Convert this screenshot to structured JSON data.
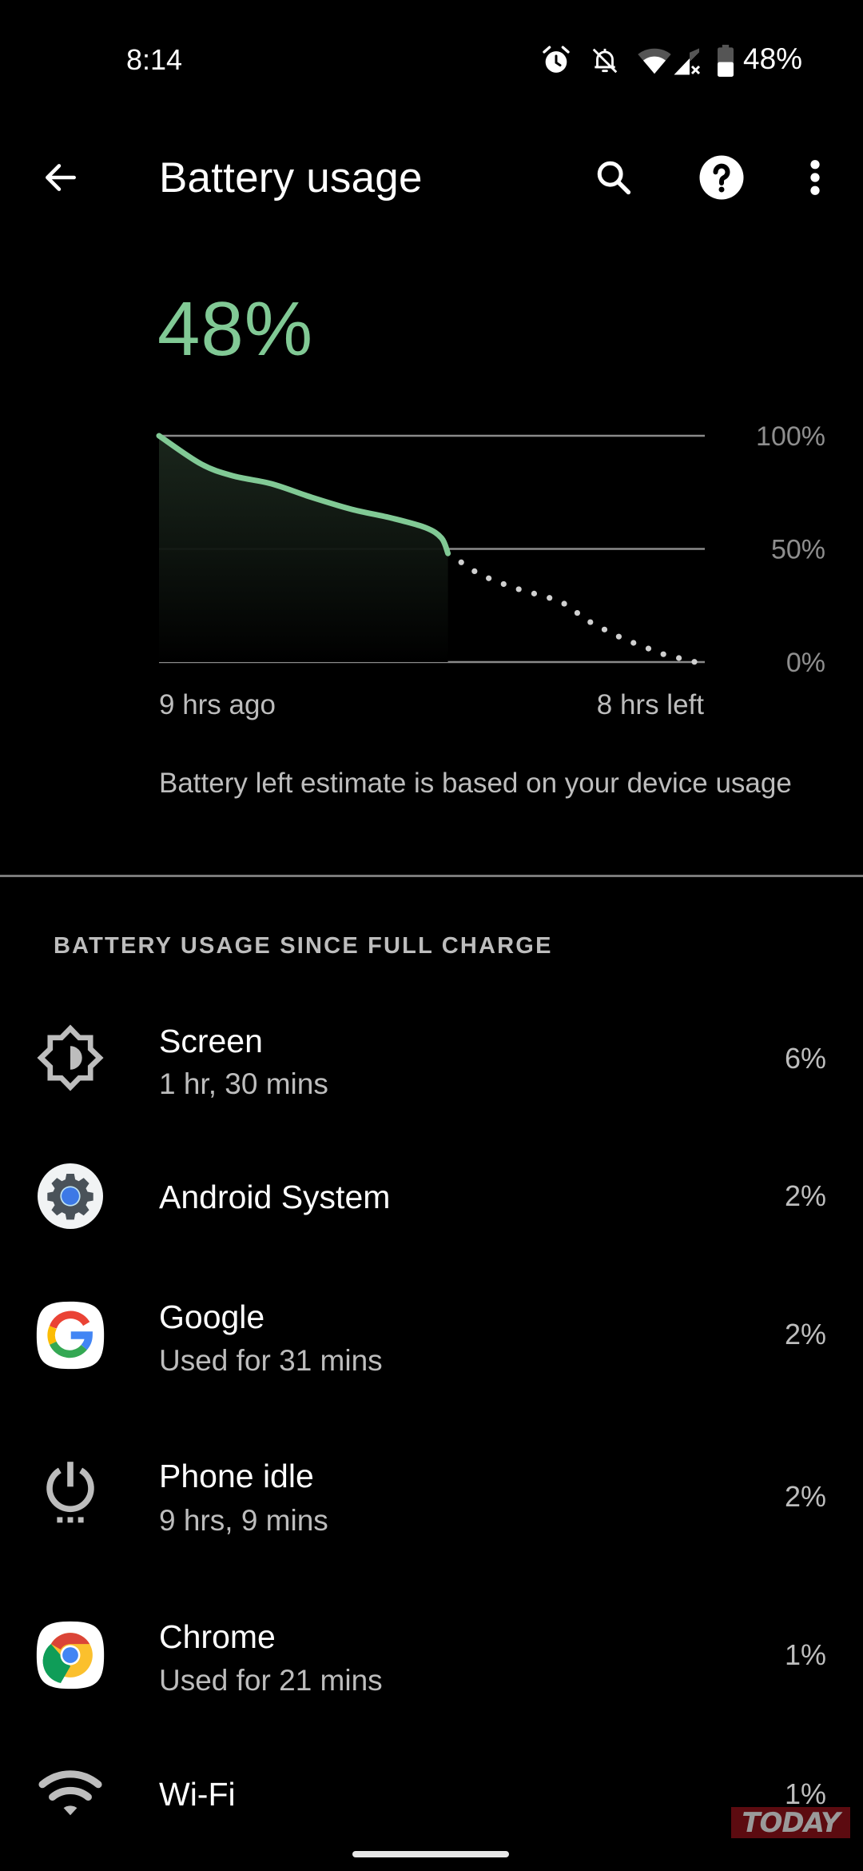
{
  "status_bar": {
    "time": "8:14",
    "icons": [
      "alarm-icon",
      "notifications-off-icon",
      "wifi-icon",
      "cell-signal-no-data-icon",
      "battery-icon"
    ],
    "battery_percent": "48%"
  },
  "app_bar": {
    "title": "Battery usage",
    "actions": [
      "back-arrow-icon",
      "search-icon",
      "help-icon",
      "more-vert-icon"
    ]
  },
  "battery": {
    "level_label": "48%",
    "level": 48,
    "color": "#81c995"
  },
  "chart_data": {
    "type": "line",
    "title": "",
    "xlabel": "",
    "ylabel": "",
    "x_unit": "hours",
    "xlim": [
      0,
      17
    ],
    "ylim": [
      0,
      100
    ],
    "y_ticks": [
      "100%",
      "50%",
      "0%"
    ],
    "y_tick_values": [
      100,
      50,
      0
    ],
    "x_tick_labels": [
      "9 hrs ago",
      "8 hrs left"
    ],
    "grid": true,
    "series": [
      {
        "name": "Battery level (history)",
        "style": "solid",
        "color": "#81c995",
        "x": [
          0,
          1.3,
          2.3,
          3.5,
          4.75,
          6.0,
          7.25,
          8.3,
          8.8,
          9.0
        ],
        "y": [
          100,
          87.6,
          82.3,
          78.8,
          72.8,
          67.5,
          63.6,
          59.4,
          54.8,
          48
        ]
      },
      {
        "name": "Projected battery level",
        "style": "dotted",
        "color": "#d0d0d0",
        "x": [
          9.0,
          10.0,
          11.0,
          12.5,
          13.5,
          14.5,
          15.7,
          16.7
        ],
        "y": [
          48,
          38.5,
          33,
          27,
          17,
          10,
          3.5,
          0
        ]
      }
    ]
  },
  "estimate_note": "Battery left estimate is based on your device usage",
  "section_header": "BATTERY USAGE SINCE FULL CHARGE",
  "usage_items": [
    {
      "icon": "brightness-icon",
      "title": "Screen",
      "subtitle": "1 hr, 30 mins",
      "percent": "6%"
    },
    {
      "icon": "android-system-gear-icon",
      "title": "Android System",
      "subtitle": "",
      "percent": "2%"
    },
    {
      "icon": "google-icon",
      "title": "Google",
      "subtitle": "Used for 31 mins",
      "percent": "2%"
    },
    {
      "icon": "power-idle-icon",
      "title": "Phone idle",
      "subtitle": "9 hrs, 9 mins",
      "percent": "2%"
    },
    {
      "icon": "chrome-icon",
      "title": "Chrome",
      "subtitle": "Used for 21 mins",
      "percent": "1%"
    },
    {
      "icon": "wifi-icon",
      "title": "Wi-Fi",
      "subtitle": "",
      "percent": "1%"
    }
  ],
  "watermark": "TODAY"
}
